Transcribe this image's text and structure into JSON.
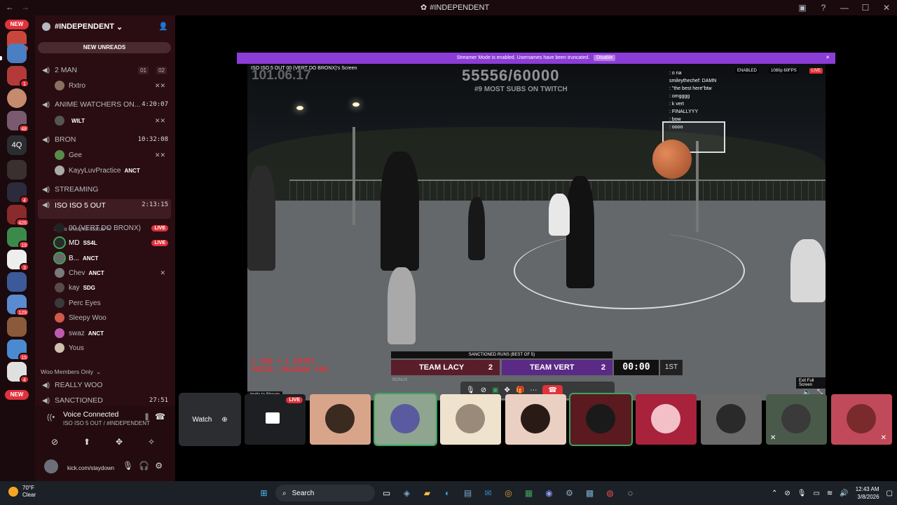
{
  "titlebar": {
    "title": "#INDEPENDENT"
  },
  "servers": {
    "new_top": "NEW",
    "new_bottom": "NEW",
    "folder_label": "4Q",
    "badges": [
      "4",
      "1",
      "48",
      "4",
      "426",
      "19",
      "3",
      "129",
      "15",
      "4"
    ]
  },
  "sidebar": {
    "server_name": "#INDEPENDENT",
    "new_unreads": "NEW UNREADS",
    "channels": {
      "two_man": {
        "name": "2 MAN",
        "count_a": "01",
        "count_b": "02",
        "user": "Rxtro"
      },
      "anime": {
        "name": "ANIME WATCHERS ON...",
        "time": "4:20:07",
        "user": "WILT"
      },
      "bron": {
        "name": "BRON",
        "time": "10:32:08",
        "users": [
          {
            "name": "Gee"
          },
          {
            "name": "KayyLuvPractice",
            "tag": "ANCT"
          }
        ]
      },
      "streaming": {
        "name": "STREAMING"
      },
      "iso": {
        "name": "ISO ISO 5 OUT",
        "time": "2:13:15",
        "status": "Set a channel status",
        "users": [
          {
            "name": "00 (VERT DO BRONX)",
            "live": "LIVE"
          },
          {
            "name": "MD",
            "tag": "SS4L",
            "live": "LIVE"
          },
          {
            "name": "B...",
            "tag": "ANCT"
          },
          {
            "name": "Chev",
            "tag": "ANCT"
          },
          {
            "name": "kay",
            "tag": "SDG"
          },
          {
            "name": "Perc Eyes"
          },
          {
            "name": "Sleepy Woo"
          },
          {
            "name": "swaz",
            "tag": "ANCT"
          },
          {
            "name": "Yous"
          }
        ]
      },
      "members_only": "Woo Members Only",
      "really_woo": {
        "name": "REALLY WOO"
      },
      "sanctioned": {
        "name": "SANCTIONED",
        "time": "27:51"
      }
    },
    "voice": {
      "status": "Voice Connected",
      "sub": "ISO ISO 5 OUT / #INDEPENDENT"
    },
    "user": {
      "name": "kick.com/staydown"
    }
  },
  "stream": {
    "banner": {
      "text": "Streamer Mode is enabled. Usernames have been truncated.",
      "button": "Disable"
    },
    "top_label": "ISO ISO 5 OUT   00 (VERT DO BRONX)'s Screen",
    "ghost": "101.06.17",
    "count": "55556/60000",
    "rank": "#9 MOST SUBS ON TWITCH",
    "chat": [
      ": o na",
      "smileythechef: DAMN",
      ": \"the best here\"btw",
      ": omgggg",
      ": k vert",
      ": FINALLYYY",
      "",
      ": bow",
      ": oooo"
    ],
    "stats": {
      "enabled": "ENABLED",
      "quality": "1080p 60FPS",
      "live": "LIVE"
    },
    "sub_line1": "1 SUB = 1 ENTRY",
    "sub_line2": "PRIZE: MACBOOK PRO",
    "scoreboard": {
      "title": "SANCTIONED RUNS (BEST OF 5)",
      "team_a": "TEAM LACY",
      "score_a": "2",
      "team_b": "TEAM VERT",
      "score_b": "2",
      "clock": "00:00",
      "period": "1ST",
      "bonus": "BONUS"
    },
    "invite_tooltip": "Invite to Stream",
    "exit_tooltip": "Exit Full Screen"
  },
  "strip": {
    "watch": "Watch",
    "live": "LIVE"
  },
  "taskbar": {
    "temp": "70°F",
    "weather": "Clear",
    "search": "Search",
    "time": "12:43 AM",
    "date": "3/8/2026"
  }
}
